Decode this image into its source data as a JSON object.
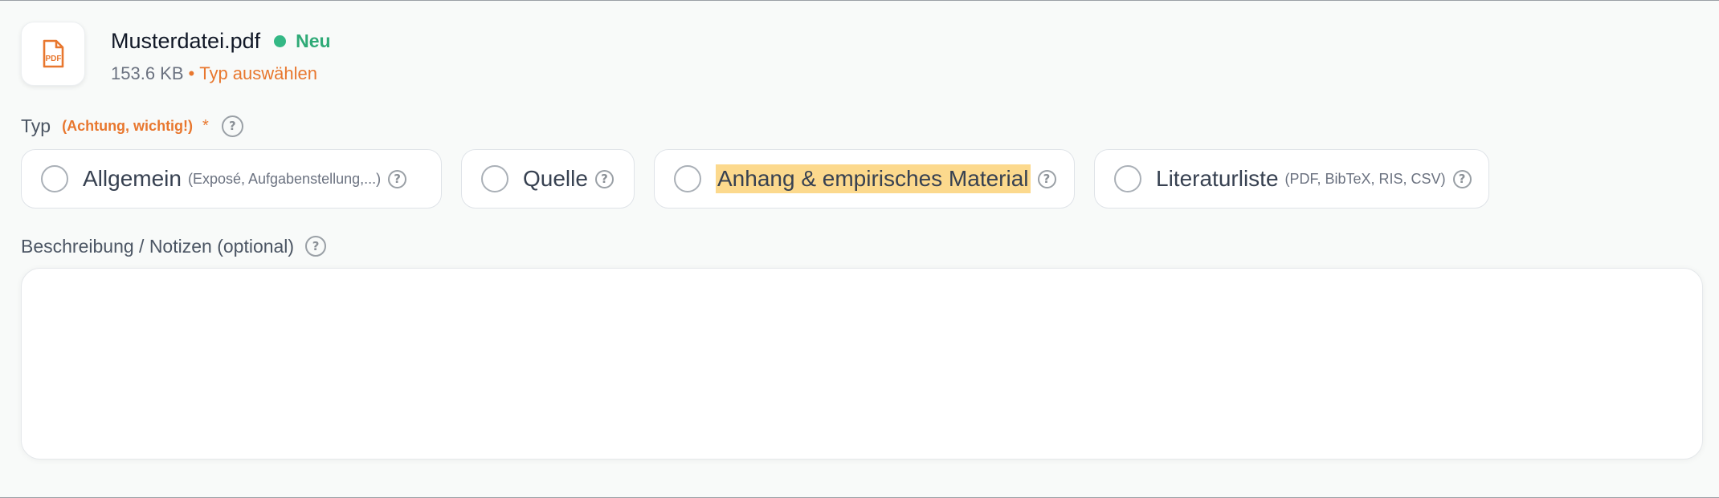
{
  "file": {
    "name": "Musterdatei.pdf",
    "status": "Neu",
    "size": "153.6 KB",
    "bullet": "•",
    "type_link": "Typ auswählen",
    "icon_text": "PDF",
    "icon": "pdf-file-icon"
  },
  "type_field": {
    "label": "Typ",
    "warning": "(Achtung, wichtig!)",
    "required_marker": "*",
    "options": [
      {
        "label": "Allgemein",
        "hint": "(Exposé, Aufgabenstellung,...)",
        "selected": false,
        "highlighted": false
      },
      {
        "label": "Quelle",
        "hint": "",
        "selected": false,
        "highlighted": false
      },
      {
        "label": "Anhang & empirisches Material",
        "hint": "",
        "selected": false,
        "highlighted": true
      },
      {
        "label": "Literaturliste",
        "hint": "(PDF, BibTeX, RIS, CSV)",
        "selected": false,
        "highlighted": false
      }
    ]
  },
  "description": {
    "label": "Beschreibung / Notizen (optional)",
    "value": "",
    "placeholder": ""
  },
  "help_glyph": "?",
  "colors": {
    "accent_orange": "#e8772e",
    "status_green": "#34b885",
    "highlight": "#fcd98d"
  }
}
